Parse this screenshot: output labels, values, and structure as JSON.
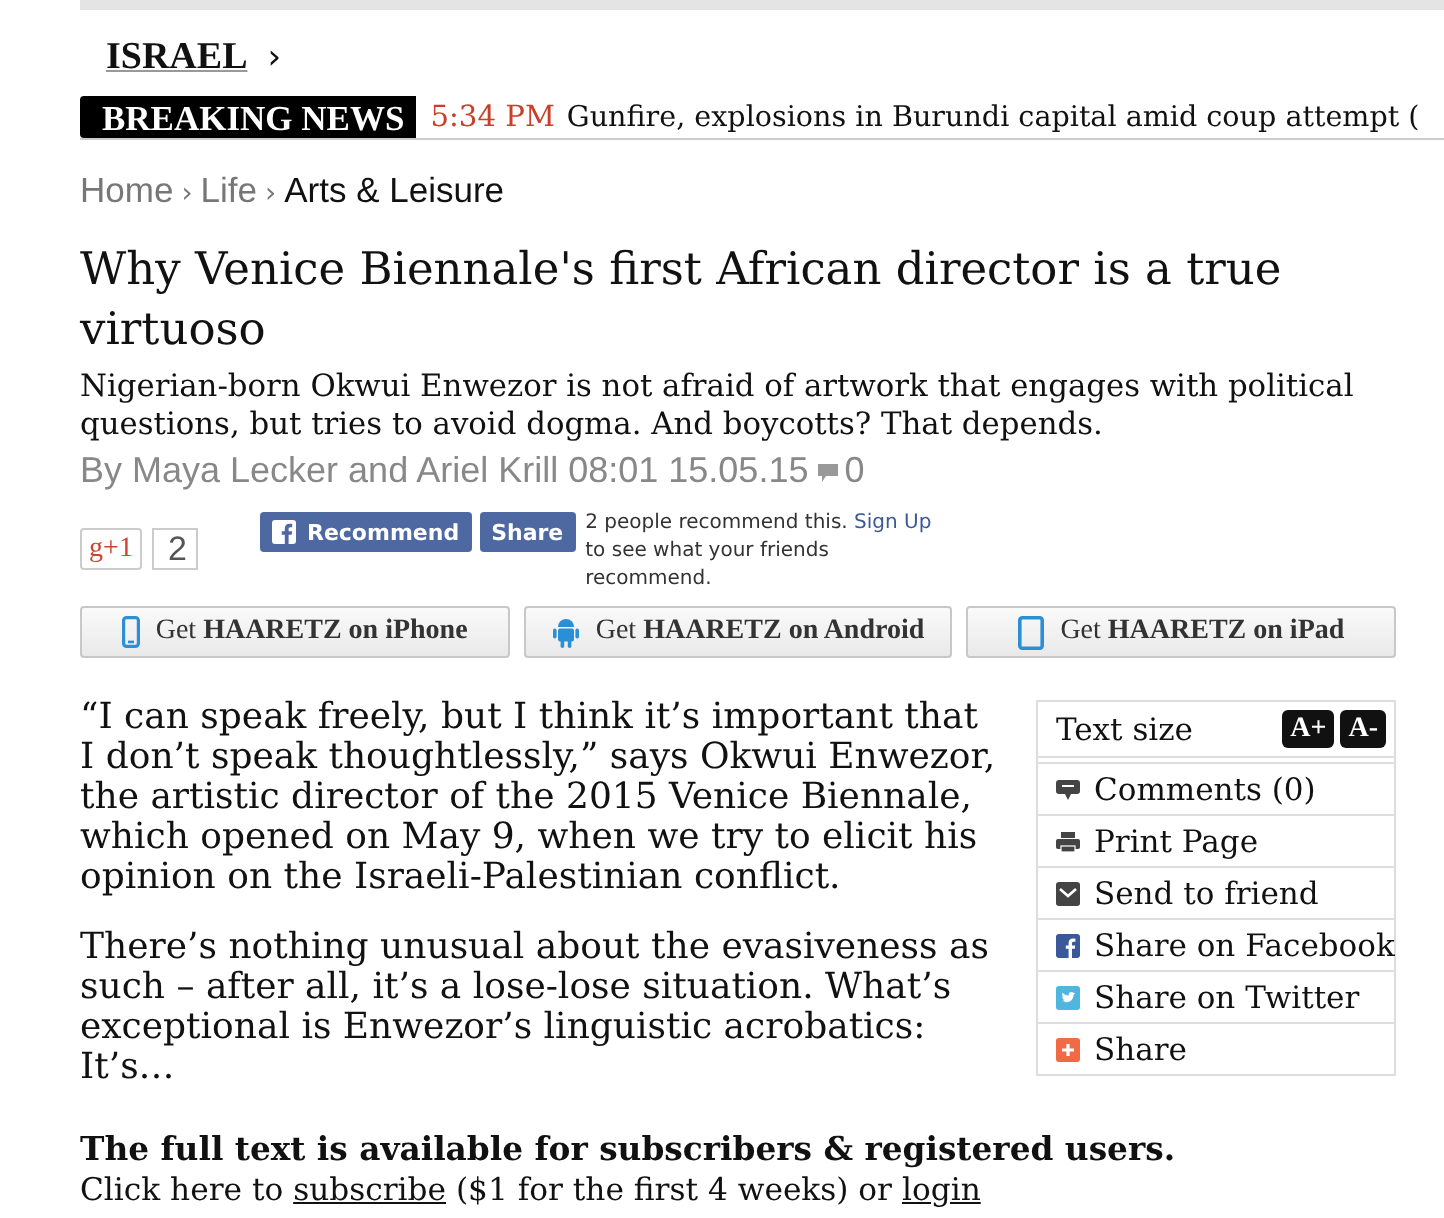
{
  "section": {
    "label": "ISRAEL",
    "chevron": "›"
  },
  "breaking_news": {
    "label": "BREAKING NEWS",
    "time": "5:34 PM",
    "headline": "Gunfire, explosions in Burundi capital amid coup attempt ("
  },
  "breadcrumb": [
    {
      "label": "Home",
      "current": false,
      "separator": "›"
    },
    {
      "label": "Life",
      "current": false,
      "separator": "›"
    },
    {
      "label": "Arts & Leisure",
      "current": true
    }
  ],
  "article": {
    "title": "Why Venice Biennale's first African director is a true virtuoso",
    "subtitle": "Nigerian-born Okwui Enwezor is not afraid of artwork that engages with political questions, but tries to avoid dogma. And boycotts? That depends.",
    "byline": "By Maya Lecker and Ariel Krill 08:01 15.05.15",
    "comment_count": "0"
  },
  "social": {
    "gplus_label": "g+1",
    "gplus_count": "2",
    "recommend": "Recommend",
    "share": "Share",
    "note": "2 people recommend this.",
    "note_link": "Sign Up",
    "note_rest": "to see what your friends recommend."
  },
  "app_buttons": [
    {
      "kind": "iphone",
      "label": "Get **HAARETZ on iPhone**"
    },
    {
      "kind": "android",
      "label": "Get **HAARETZ on Android**"
    },
    {
      "kind": "ipad",
      "label": "Get **HAARETZ on iPad**"
    }
  ],
  "body": [
    "“I can speak freely, but I think it’s important that I don’t speak thoughtlessly,” says Okwui Enwezor, the artistic director of the 2015 Venice Biennale, which opened on May 9, when we try to elicit his opinion on the Israeli-Palestinian conflict.",
    "There’s nothing unusual about the evasiveness as such – after all, it’s a lose-lose situation. What’s exceptional is Enwezor’s linguistic acrobatics: It’s…"
  ],
  "tools": {
    "title": "Text size",
    "size_buttons": [
      "A+",
      "A-"
    ],
    "items": [
      {
        "kind": "comments",
        "label": "Comments (0)"
      },
      {
        "kind": "print",
        "label": "Print Page"
      },
      {
        "kind": "email",
        "label": "Send to friend"
      },
      {
        "kind": "facebook",
        "label": "Share on Facebook"
      },
      {
        "kind": "twitter",
        "label": "Share on Twitter"
      },
      {
        "kind": "share",
        "label": "Share"
      }
    ]
  },
  "paywall": {
    "notice": "The full text is available for subscribers & registered users.",
    "prompt_start": "Click here to",
    "subscribe_link": "subscribe",
    "prompt_middle": "($1 for the first 4 weeks) or",
    "login_link": "login"
  }
}
